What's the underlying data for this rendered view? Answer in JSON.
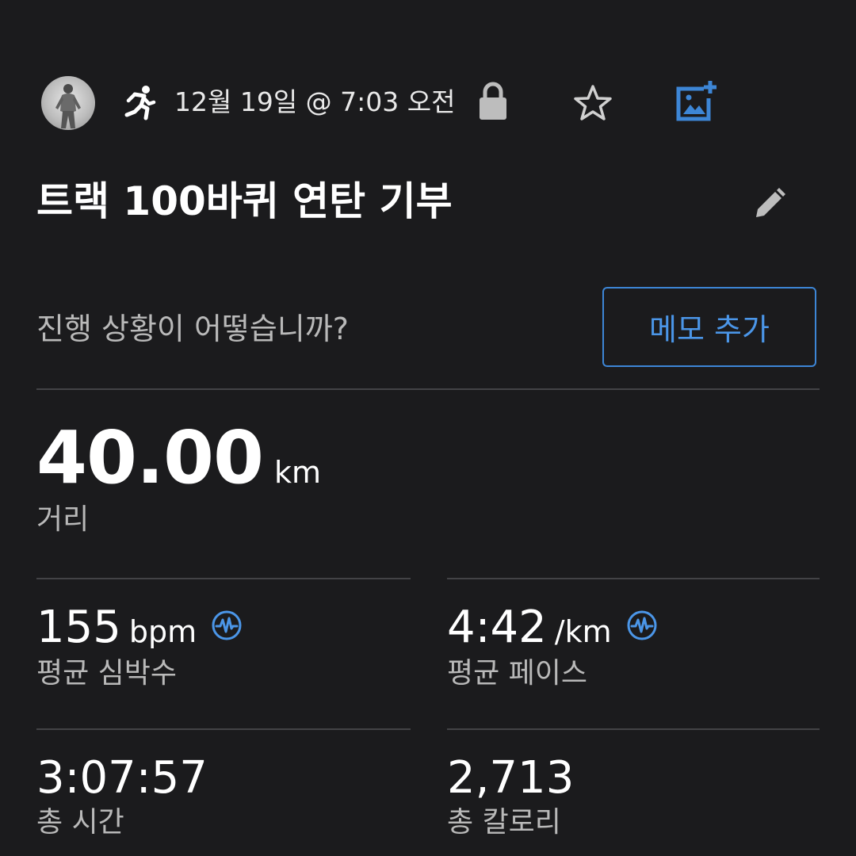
{
  "header": {
    "date_time": "12월 19일 @ 7:03 오전",
    "icons": [
      "avatar",
      "running-icon",
      "lock-icon",
      "star-icon",
      "add-photo-icon"
    ]
  },
  "activity": {
    "title": "트랙 100바퀴 연탄 기부"
  },
  "note": {
    "prompt": "진행 상황이 어떻습니까?",
    "button_label": "메모 추가"
  },
  "stats": {
    "distance": {
      "value": "40.00",
      "unit": "km",
      "label": "거리"
    },
    "avg_heart_rate": {
      "value": "155",
      "unit": "bpm",
      "label": "평균 심박수"
    },
    "avg_pace": {
      "value": "4:42",
      "unit": "/km",
      "label": "평균 페이스"
    },
    "total_time": {
      "value": "3:07:57",
      "label": "총 시간"
    },
    "total_calories": {
      "value": "2,713",
      "label": "총 칼로리"
    }
  },
  "colors": {
    "background": "#1b1b1d",
    "accent": "#3d86d6",
    "secondary_text": "#b9b9b9",
    "divider": "#434346"
  }
}
